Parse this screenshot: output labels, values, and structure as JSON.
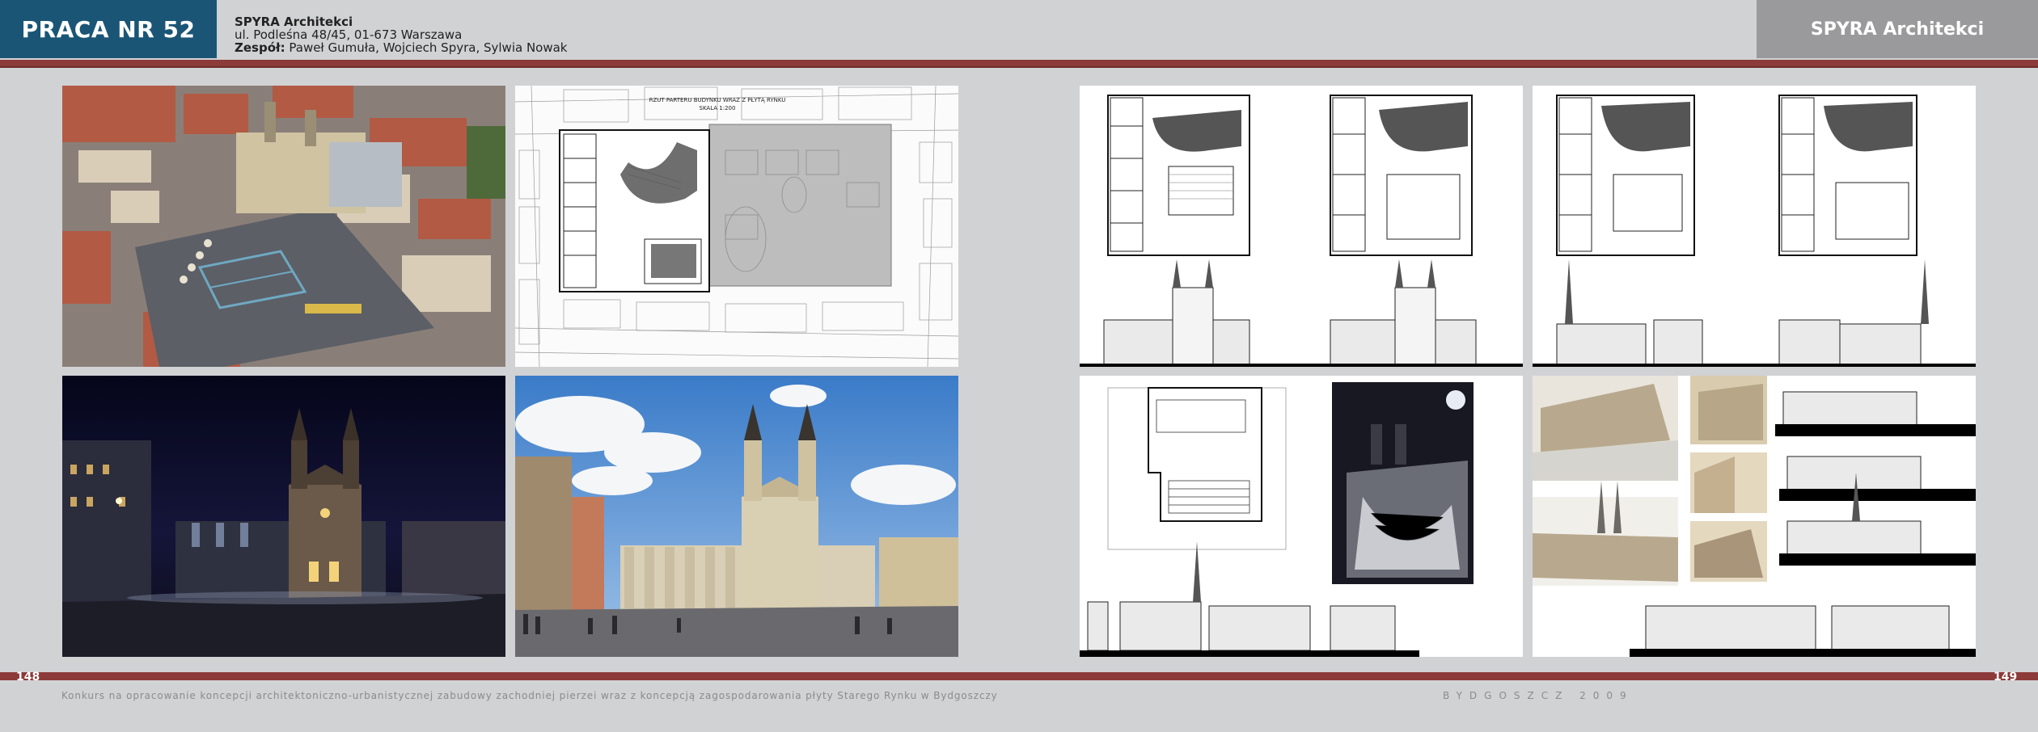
{
  "header": {
    "work_number": "PRACA NR 52",
    "firm": "SPYRA Architekci",
    "address": "ul. Podleśna 48/45, 01-673 Warszawa",
    "team_label": "Zespół:",
    "team_members": "Paweł Gumuła, Wojciech Spyra, Sylwia Nowak",
    "right_firm": "SPYRA Architekci"
  },
  "plan": {
    "title_line1": "RZUT PARTERU BUDYNKU WRAZ Z PŁYTĄ RYNKU",
    "title_line2": "SKALA 1:200"
  },
  "footer": {
    "page_left": "148",
    "page_right": "149",
    "competition": "Konkurs na opracowanie koncepcji architektoniczno-urbanistycznej zabudowy zachodniej pierzei wraz z koncepcją zagospodarowania płyty Starego Rynku w Bydgoszczy",
    "city_year": "BYDGOSZCZ 2009"
  },
  "colors": {
    "title_box": "#1a5576",
    "band": "#8c3a3a",
    "right_header": "#9a9a9c",
    "page_bg": "#d1d2d4"
  }
}
